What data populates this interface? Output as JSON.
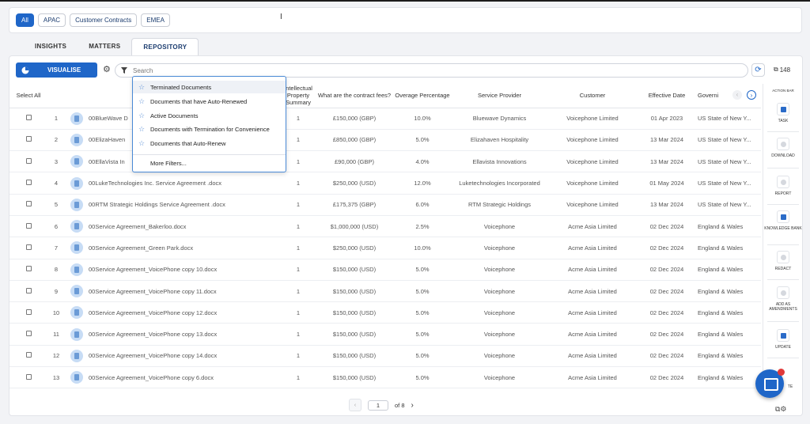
{
  "filters": [
    "All",
    "APAC",
    "Customer Contracts",
    "EMEA"
  ],
  "tabs": [
    "INSIGHTS",
    "MATTERS",
    "REPOSITORY"
  ],
  "toolbar": {
    "visualise_label": "VISUALISE",
    "search_placeholder": "Search",
    "count": "148"
  },
  "columns": {
    "select_all": "Select All",
    "ip": "Intellectual Property Summary",
    "fees": "What are the contract fees?",
    "overage": "Overage Percentage",
    "provider": "Service Provider",
    "customer": "Customer",
    "effective": "Effective Date",
    "governing": "Governi"
  },
  "rows": [
    {
      "n": "1",
      "doc": "00BlueWave D",
      "ip": "1",
      "fees": "£150,000 (GBP)",
      "overage": "10.0%",
      "provider": "Bluewave Dynamics",
      "customer": "Voicephone Limited",
      "date": "01 Apr 2023",
      "law": "US State of New Y..."
    },
    {
      "n": "2",
      "doc": "00ElizaHaven",
      "ip": "1",
      "fees": "£850,000 (GBP)",
      "overage": "5.0%",
      "provider": "Elizahaven Hospitality",
      "customer": "Voicephone Limited",
      "date": "13 Mar 2024",
      "law": "US State of New Y..."
    },
    {
      "n": "3",
      "doc": "00EllaVista In",
      "ip": "1",
      "fees": "£90,000 (GBP)",
      "overage": "4.0%",
      "provider": "Ellavista Innovations",
      "customer": "Voicephone Limited",
      "date": "13 Mar 2024",
      "law": "US State of New Y..."
    },
    {
      "n": "4",
      "doc": "00LukeTechnologies Inc. Service Agreement .docx",
      "ip": "1",
      "fees": "$250,000 (USD)",
      "overage": "12.0%",
      "provider": "Luketechnologies Incorporated",
      "customer": "Voicephone Limited",
      "date": "01 May 2024",
      "law": "US State of New Y..."
    },
    {
      "n": "5",
      "doc": "00RTM Strategic Holdings Service Agreement .docx",
      "ip": "1",
      "fees": "£175,375 (GBP)",
      "overage": "6.0%",
      "provider": "RTM Strategic Holdings",
      "customer": "Voicephone Limited",
      "date": "13 Mar 2024",
      "law": "US State of New Y..."
    },
    {
      "n": "6",
      "doc": "00Service Agreement_Bakerloo.docx",
      "ip": "1",
      "fees": "$1,000,000 (USD)",
      "overage": "2.5%",
      "provider": "Voicephone",
      "customer": "Acme Asia Limited",
      "date": "02 Dec 2024",
      "law": "England & Wales"
    },
    {
      "n": "7",
      "doc": "00Service Agreement_Green Park.docx",
      "ip": "1",
      "fees": "$250,000 (USD)",
      "overage": "10.0%",
      "provider": "Voicephone",
      "customer": "Acme Asia Limited",
      "date": "02 Dec 2024",
      "law": "England & Wales"
    },
    {
      "n": "8",
      "doc": "00Service Agreement_VoicePhone copy 10.docx",
      "ip": "1",
      "fees": "$150,000 (USD)",
      "overage": "5.0%",
      "provider": "Voicephone",
      "customer": "Acme Asia Limited",
      "date": "02 Dec 2024",
      "law": "England & Wales"
    },
    {
      "n": "9",
      "doc": "00Service Agreement_VoicePhone copy 11.docx",
      "ip": "1",
      "fees": "$150,000 (USD)",
      "overage": "5.0%",
      "provider": "Voicephone",
      "customer": "Acme Asia Limited",
      "date": "02 Dec 2024",
      "law": "England & Wales"
    },
    {
      "n": "10",
      "doc": "00Service Agreement_VoicePhone copy 12.docx",
      "ip": "1",
      "fees": "$150,000 (USD)",
      "overage": "5.0%",
      "provider": "Voicephone",
      "customer": "Acme Asia Limited",
      "date": "02 Dec 2024",
      "law": "England & Wales"
    },
    {
      "n": "11",
      "doc": "00Service Agreement_VoicePhone copy 13.docx",
      "ip": "1",
      "fees": "$150,000 (USD)",
      "overage": "5.0%",
      "provider": "Voicephone",
      "customer": "Acme Asia Limited",
      "date": "02 Dec 2024",
      "law": "England & Wales"
    },
    {
      "n": "12",
      "doc": "00Service Agreement_VoicePhone copy 14.docx",
      "ip": "1",
      "fees": "$150,000 (USD)",
      "overage": "5.0%",
      "provider": "Voicephone",
      "customer": "Acme Asia Limited",
      "date": "02 Dec 2024",
      "law": "England & Wales"
    },
    {
      "n": "13",
      "doc": "00Service Agreement_VoicePhone copy 6.docx",
      "ip": "1",
      "fees": "$150,000 (USD)",
      "overage": "5.0%",
      "provider": "Voicephone",
      "customer": "Acme Asia Limited",
      "date": "02 Dec 2024",
      "law": "England & Wales"
    }
  ],
  "dropdown": {
    "items": [
      "Terminated Documents",
      "Documents that have Auto-Renewed",
      "Active Documents",
      "Documents with Termination for Convenience",
      "Documents that Auto-Renew"
    ],
    "more": "More Filters..."
  },
  "action_bar": {
    "title": "ACTION BAR",
    "items": [
      "TASK",
      "DOWNLOAD",
      "REPORT",
      "KNOWLEDGE BANK",
      "REDACT",
      "ADD AS AMENDMENTS",
      "UPDATE",
      "TE"
    ]
  },
  "pager": {
    "page": "1",
    "of": "of 8"
  },
  "colors": {
    "accent": "#1f66c8"
  }
}
